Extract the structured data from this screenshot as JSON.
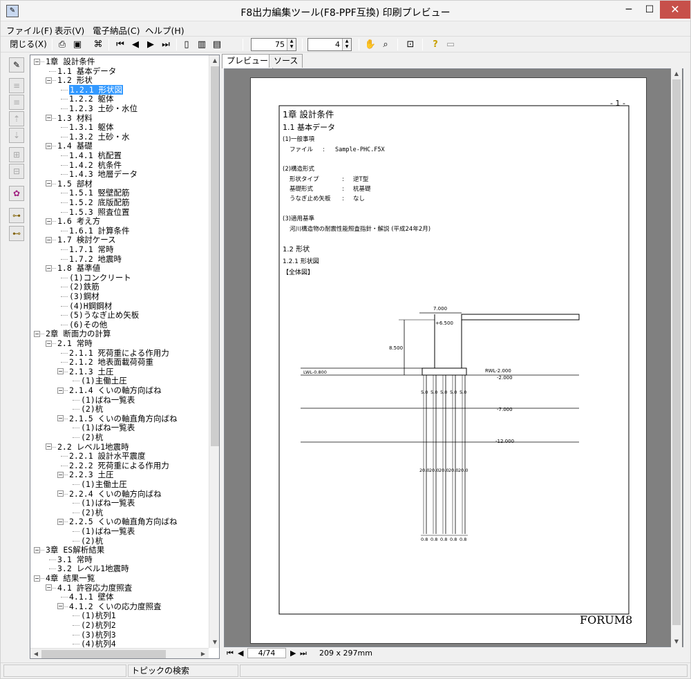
{
  "window": {
    "title": "F8出力編集ツール(F8-PPF互換) 印刷プレビュー",
    "min": "─",
    "max": "☐",
    "close": "✕"
  },
  "menu": [
    "ファイル(F)",
    "表示(V)",
    "電子納品(C)",
    "ヘルプ(H)"
  ],
  "toolbar": {
    "close_label": "閉じる(X)",
    "zoom_value": "75",
    "page_spin_value": "4"
  },
  "tabs": [
    "プレビュー",
    "ソース"
  ],
  "tree": [
    {
      "d": 0,
      "t": "1章 設計条件",
      "tog": "-"
    },
    {
      "d": 1,
      "t": "1.1 基本データ"
    },
    {
      "d": 1,
      "t": "1.2 形状",
      "tog": "-"
    },
    {
      "d": 2,
      "t": "1.2.1 形状図",
      "sel": true
    },
    {
      "d": 2,
      "t": "1.2.2 躯体"
    },
    {
      "d": 2,
      "t": "1.2.3 土砂・水位"
    },
    {
      "d": 1,
      "t": "1.3 材料",
      "tog": "-"
    },
    {
      "d": 2,
      "t": "1.3.1 躯体"
    },
    {
      "d": 2,
      "t": "1.3.2 土砂・水"
    },
    {
      "d": 1,
      "t": "1.4 基礎",
      "tog": "-"
    },
    {
      "d": 2,
      "t": "1.4.1 杭配置"
    },
    {
      "d": 2,
      "t": "1.4.2 杭条件"
    },
    {
      "d": 2,
      "t": "1.4.3 地層データ"
    },
    {
      "d": 1,
      "t": "1.5 部材",
      "tog": "-"
    },
    {
      "d": 2,
      "t": "1.5.1 竪壁配筋"
    },
    {
      "d": 2,
      "t": "1.5.2 底版配筋"
    },
    {
      "d": 2,
      "t": "1.5.3 照査位置"
    },
    {
      "d": 1,
      "t": "1.6 考え方",
      "tog": "-"
    },
    {
      "d": 2,
      "t": "1.6.1 計算条件"
    },
    {
      "d": 1,
      "t": "1.7 検討ケース",
      "tog": "-"
    },
    {
      "d": 2,
      "t": "1.7.1 常時"
    },
    {
      "d": 2,
      "t": "1.7.2 地震時"
    },
    {
      "d": 1,
      "t": "1.8 基準値",
      "tog": "-"
    },
    {
      "d": 2,
      "t": "(1)コンクリート"
    },
    {
      "d": 2,
      "t": "(2)鉄筋"
    },
    {
      "d": 2,
      "t": "(3)鋼材"
    },
    {
      "d": 2,
      "t": "(4)H鋼鋼材"
    },
    {
      "d": 2,
      "t": "(5)うなぎ止め矢板"
    },
    {
      "d": 2,
      "t": "(6)その他"
    },
    {
      "d": 0,
      "t": "2章 断面力の計算",
      "tog": "-"
    },
    {
      "d": 1,
      "t": "2.1 常時",
      "tog": "-"
    },
    {
      "d": 2,
      "t": "2.1.1 死荷重による作用力"
    },
    {
      "d": 2,
      "t": "2.1.2 地表面載荷荷重"
    },
    {
      "d": 2,
      "t": "2.1.3 土圧",
      "tog": "-"
    },
    {
      "d": 3,
      "t": "(1)主働土圧"
    },
    {
      "d": 2,
      "t": "2.1.4 くいの軸方向ばね",
      "tog": "-"
    },
    {
      "d": 3,
      "t": "(1)ばね一覧表"
    },
    {
      "d": 3,
      "t": "(2)杭"
    },
    {
      "d": 2,
      "t": "2.1.5 くいの軸直角方向ばね",
      "tog": "-"
    },
    {
      "d": 3,
      "t": "(1)ばね一覧表"
    },
    {
      "d": 3,
      "t": "(2)杭"
    },
    {
      "d": 1,
      "t": "2.2 レベル1地震時",
      "tog": "-"
    },
    {
      "d": 2,
      "t": "2.2.1 設計水平震度"
    },
    {
      "d": 2,
      "t": "2.2.2 死荷重による作用力"
    },
    {
      "d": 2,
      "t": "2.2.3 土圧",
      "tog": "-"
    },
    {
      "d": 3,
      "t": "(1)主働土圧"
    },
    {
      "d": 2,
      "t": "2.2.4 くいの軸方向ばね",
      "tog": "-"
    },
    {
      "d": 3,
      "t": "(1)ばね一覧表"
    },
    {
      "d": 3,
      "t": "(2)杭"
    },
    {
      "d": 2,
      "t": "2.2.5 くいの軸直角方向ばね",
      "tog": "-"
    },
    {
      "d": 3,
      "t": "(1)ばね一覧表"
    },
    {
      "d": 3,
      "t": "(2)杭"
    },
    {
      "d": 0,
      "t": "3章 ES解析結果",
      "tog": "-"
    },
    {
      "d": 1,
      "t": "3.1 常時"
    },
    {
      "d": 1,
      "t": "3.2 レベル1地震時"
    },
    {
      "d": 0,
      "t": "4章 結果一覧",
      "tog": "-"
    },
    {
      "d": 1,
      "t": "4.1 許容応力度照査",
      "tog": "-"
    },
    {
      "d": 2,
      "t": "4.1.1 壁体"
    },
    {
      "d": 2,
      "t": "4.1.2 くいの応力度照査",
      "tog": "-"
    },
    {
      "d": 3,
      "t": "(1)杭列1"
    },
    {
      "d": 3,
      "t": "(2)杭列2"
    },
    {
      "d": 3,
      "t": "(3)杭列3"
    },
    {
      "d": 3,
      "t": "(4)杭列4"
    }
  ],
  "doc": {
    "page_mark": "- 1 -",
    "h1": "1章 設計条件",
    "h2_basic": "1.1 基本データ",
    "sec1": "(1)一般事項",
    "file_label": "ファイル",
    "file_sep": ":",
    "file_value": "Sample-PHC.F5X",
    "sec2": "(2)構造形式",
    "row1_label": "形状タイプ",
    "row1_value": "逆T型",
    "row2_label": "基礎形式",
    "row2_value": "杭基礎",
    "row3_label": "うなぎ止め矢板",
    "row3_value": "なし",
    "sep": ":",
    "sec3": "(3)適用基準",
    "standard": "河川構造物の耐震性能照査指針・解説 (平成24年2月)",
    "h2_shape": "1.2 形状",
    "h3_shape": "1.2.1 形状図",
    "overall": "【全体図】",
    "dim_top": "7.000",
    "dim_height": "8.500",
    "lv_top": "+6.500",
    "lv_left": "LWL-0.800",
    "rwl": "RWL-2.000",
    "lv_m2": "-2.000",
    "lv_m7": "-7.000",
    "lv_m12": "-12.000",
    "pile_upper": [
      "5.0",
      "5.0",
      "5.0",
      "5.0",
      "5.0"
    ],
    "pile_lower": [
      "20.0",
      "20.0",
      "20.0",
      "20.0",
      "20.0"
    ],
    "pile_pitch": [
      "0.8",
      "0.8",
      "0.8",
      "0.8",
      "0.8"
    ],
    "logo": "FORUM8"
  },
  "pagenav": {
    "first": "⏮",
    "prev": "◀",
    "current": "4/74",
    "next": "▶",
    "last": "⏭",
    "size": "209 x 297mm"
  },
  "status": {
    "search": "トピックの検索"
  }
}
